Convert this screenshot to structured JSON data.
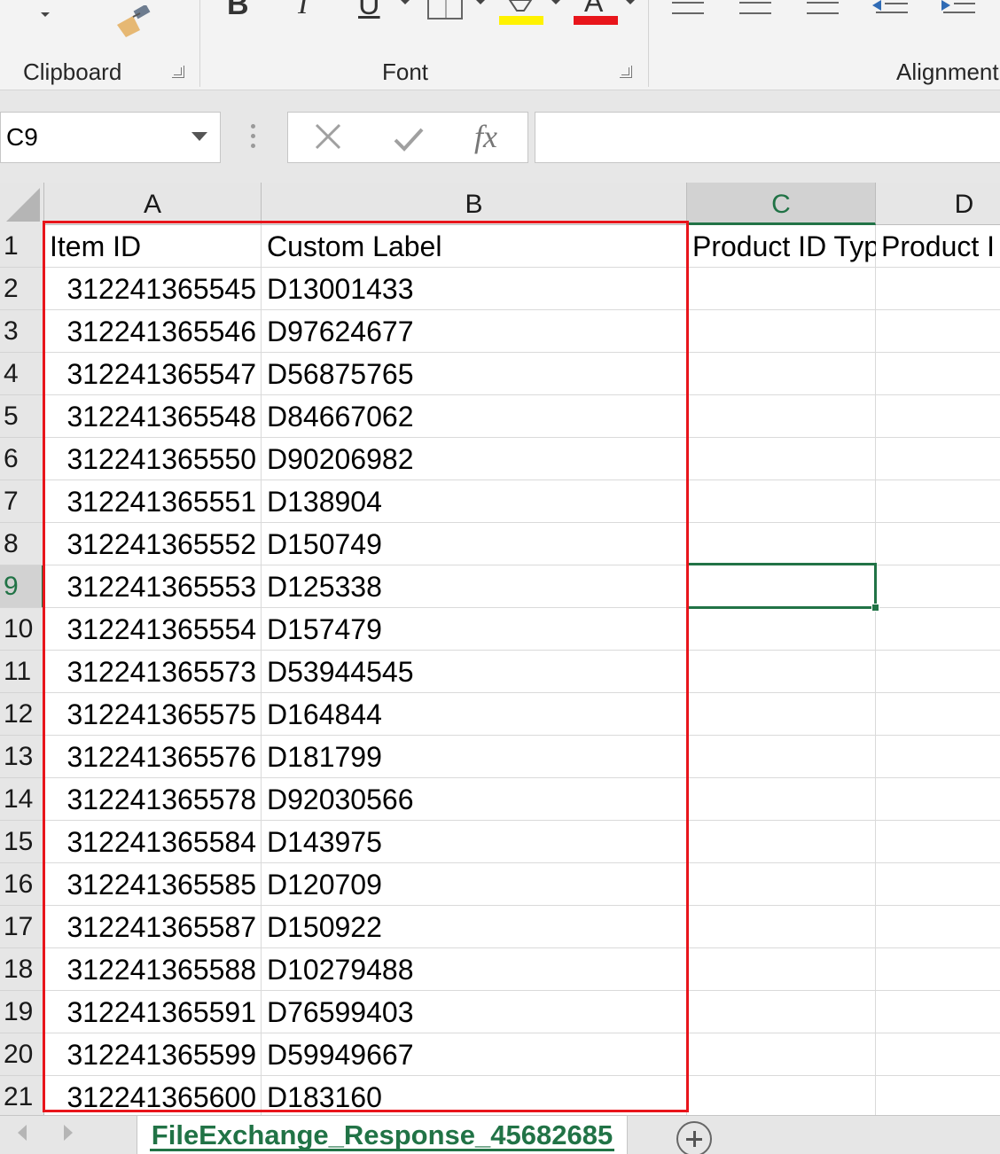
{
  "ribbon": {
    "groups": [
      {
        "label": "Clipboard"
      },
      {
        "label": "Font"
      },
      {
        "label": "Alignment"
      }
    ],
    "font_color_swatch": "#e8151b",
    "highlight_swatch": "#fff200"
  },
  "formula_bar": {
    "name_box": "C9",
    "fx_label": "fx",
    "formula_value": ""
  },
  "columns": [
    {
      "label": "A"
    },
    {
      "label": "B"
    },
    {
      "label": "C"
    },
    {
      "label": "D"
    }
  ],
  "rows": [
    {
      "num": "1",
      "a": "Item ID",
      "b": "Custom Label",
      "c": "Product ID Typ",
      "d": "Product I"
    },
    {
      "num": "2",
      "a": "312241365545",
      "b": "D13001433",
      "c": "",
      "d": ""
    },
    {
      "num": "3",
      "a": "312241365546",
      "b": "D97624677",
      "c": "",
      "d": ""
    },
    {
      "num": "4",
      "a": "312241365547",
      "b": "D56875765",
      "c": "",
      "d": ""
    },
    {
      "num": "5",
      "a": "312241365548",
      "b": "D84667062",
      "c": "",
      "d": ""
    },
    {
      "num": "6",
      "a": "312241365550",
      "b": "D90206982",
      "c": "",
      "d": ""
    },
    {
      "num": "7",
      "a": "312241365551",
      "b": "D138904",
      "c": "",
      "d": ""
    },
    {
      "num": "8",
      "a": "312241365552",
      "b": "D150749",
      "c": "",
      "d": ""
    },
    {
      "num": "9",
      "a": "312241365553",
      "b": "D125338",
      "c": "",
      "d": ""
    },
    {
      "num": "10",
      "a": "312241365554",
      "b": "D157479",
      "c": "",
      "d": ""
    },
    {
      "num": "11",
      "a": "312241365573",
      "b": "D53944545",
      "c": "",
      "d": ""
    },
    {
      "num": "12",
      "a": "312241365575",
      "b": "D164844",
      "c": "",
      "d": ""
    },
    {
      "num": "13",
      "a": "312241365576",
      "b": "D181799",
      "c": "",
      "d": ""
    },
    {
      "num": "14",
      "a": "312241365578",
      "b": "D92030566",
      "c": "",
      "d": ""
    },
    {
      "num": "15",
      "a": "312241365584",
      "b": "D143975",
      "c": "",
      "d": ""
    },
    {
      "num": "16",
      "a": "312241365585",
      "b": "D120709",
      "c": "",
      "d": ""
    },
    {
      "num": "17",
      "a": "312241365587",
      "b": "D150922",
      "c": "",
      "d": ""
    },
    {
      "num": "18",
      "a": "312241365588",
      "b": "D10279488",
      "c": "",
      "d": ""
    },
    {
      "num": "19",
      "a": "312241365591",
      "b": "D76599403",
      "c": "",
      "d": ""
    },
    {
      "num": "20",
      "a": "312241365599",
      "b": "D59949667",
      "c": "",
      "d": ""
    },
    {
      "num": "21",
      "a": "312241365600",
      "b": "D183160",
      "c": "",
      "d": ""
    }
  ],
  "selected_cell": {
    "column": "C",
    "row": "9"
  },
  "sheet_tabs": [
    {
      "label": "FileExchange_Response_45682685",
      "active": true
    }
  ],
  "colors": {
    "accent_green": "#217346",
    "annotation_red": "#e8151b"
  }
}
